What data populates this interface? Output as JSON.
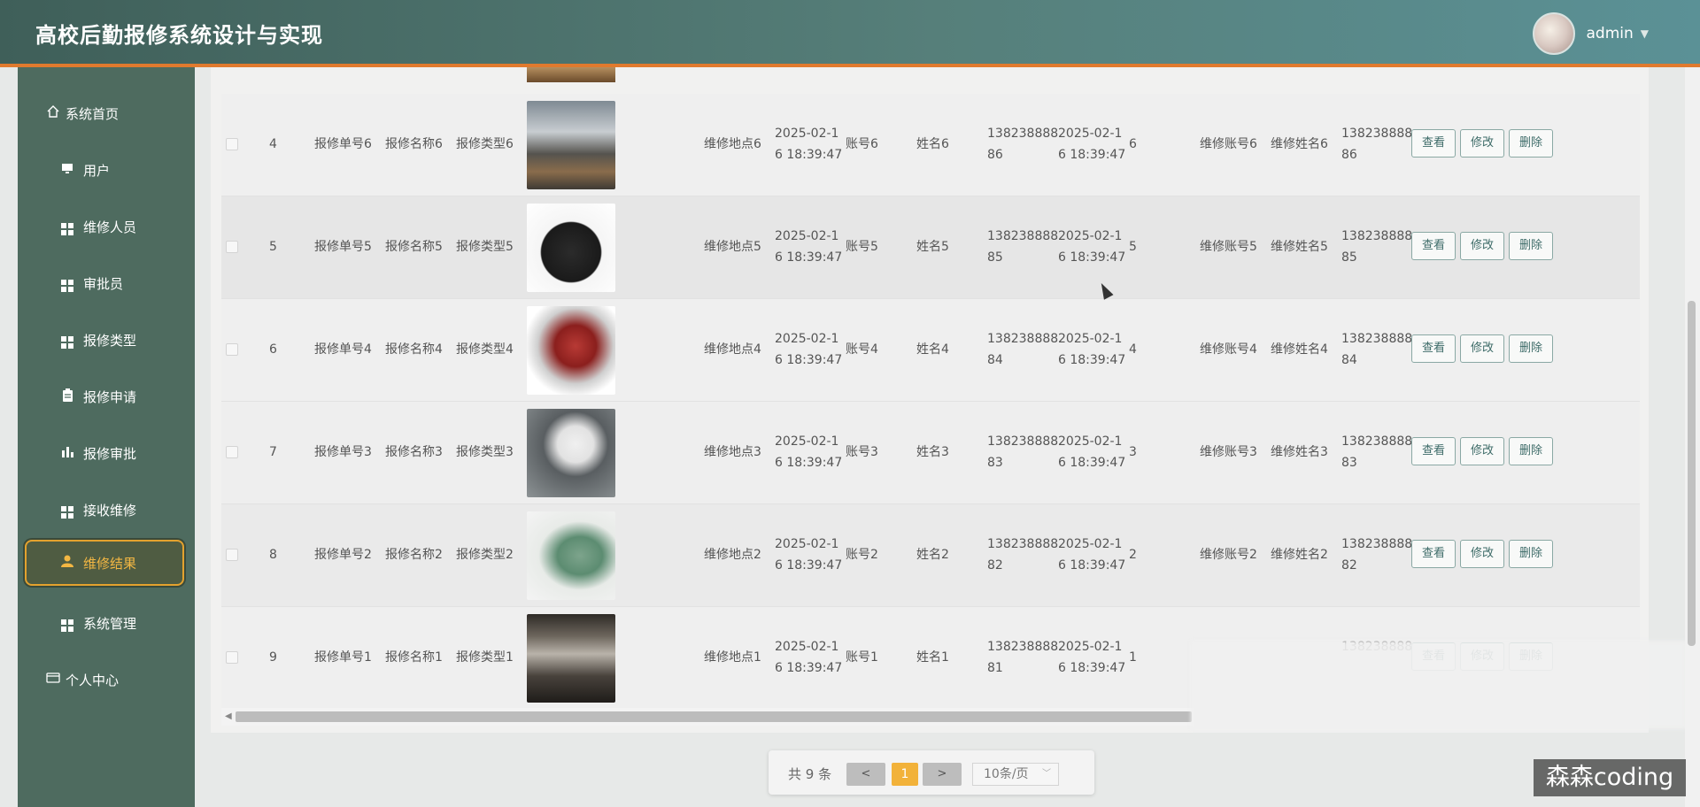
{
  "app": {
    "title": "高校后勤报修系统设计与实现"
  },
  "user": {
    "name": "admin",
    "caret": "▼"
  },
  "sidebar": {
    "items": [
      {
        "label": "系统首页",
        "icon": "home-icon"
      },
      {
        "label": "用户",
        "icon": "monitor-icon"
      },
      {
        "label": "维修人员",
        "icon": "grid-icon"
      },
      {
        "label": "审批员",
        "icon": "grid-icon"
      },
      {
        "label": "报修类型",
        "icon": "grid-icon"
      },
      {
        "label": "报修申请",
        "icon": "clipboard-icon"
      },
      {
        "label": "报修审批",
        "icon": "bar-chart-icon"
      },
      {
        "label": "接收维修",
        "icon": "grid-icon"
      },
      {
        "label": "维修结果",
        "icon": "user-icon",
        "active": true
      },
      {
        "label": "系统管理",
        "icon": "grid-icon"
      },
      {
        "label": "个人中心",
        "icon": "id-card-icon"
      }
    ]
  },
  "table": {
    "rows": [
      {
        "index": "4",
        "order_no": "报修单号6",
        "name": "报修名称6",
        "type": "报修类型6",
        "image": "kitchen",
        "location": "维修地点6",
        "time_a": "2025-02-1",
        "time_b": "6 18:39:47",
        "account": "账号6",
        "person": "姓名6",
        "phone_a": "138238888",
        "phone_b": "86",
        "time2_a": "2025-02-1",
        "time2_b": "6 18:39:47",
        "num": "6",
        "fix_account": "维修账号6",
        "fix_name": "维修姓名6",
        "fix_phone_a": "138238888",
        "fix_phone_b": "86"
      },
      {
        "index": "5",
        "order_no": "报修单号5",
        "name": "报修名称5",
        "type": "报修类型5",
        "image": "microwave",
        "location": "维修地点5",
        "time_a": "2025-02-1",
        "time_b": "6 18:39:47",
        "account": "账号5",
        "person": "姓名5",
        "phone_a": "138238888",
        "phone_b": "85",
        "time2_a": "2025-02-1",
        "time2_b": "6 18:39:47",
        "num": "5",
        "fix_account": "维修账号5",
        "fix_name": "维修姓名5",
        "fix_phone_a": "138238888",
        "fix_phone_b": "85"
      },
      {
        "index": "6",
        "order_no": "报修单号4",
        "name": "报修名称4",
        "type": "报修类型4",
        "image": "coffee-machine",
        "location": "维修地点4",
        "time_a": "2025-02-1",
        "time_b": "6 18:39:47",
        "account": "账号4",
        "person": "姓名4",
        "phone_a": "138238888",
        "phone_b": "84",
        "time2_a": "2025-02-1",
        "time2_b": "6 18:39:47",
        "num": "4",
        "fix_account": "维修账号4",
        "fix_name": "维修姓名4",
        "fix_phone_a": "138238888",
        "fix_phone_b": "84"
      },
      {
        "index": "7",
        "order_no": "报修单号3",
        "name": "报修名称3",
        "type": "报修类型3",
        "image": "robot-vacuum",
        "location": "维修地点3",
        "time_a": "2025-02-1",
        "time_b": "6 18:39:47",
        "account": "账号3",
        "person": "姓名3",
        "phone_a": "138238888",
        "phone_b": "83",
        "time2_a": "2025-02-1",
        "time2_b": "6 18:39:47",
        "num": "3",
        "fix_account": "维修账号3",
        "fix_name": "维修姓名3",
        "fix_phone_a": "138238888",
        "fix_phone_b": "83"
      },
      {
        "index": "8",
        "order_no": "报修单号2",
        "name": "报修名称2",
        "type": "报修类型2",
        "image": "kettle",
        "location": "维修地点2",
        "time_a": "2025-02-1",
        "time_b": "6 18:39:47",
        "account": "账号2",
        "person": "姓名2",
        "phone_a": "138238888",
        "phone_b": "82",
        "time2_a": "2025-02-1",
        "time2_b": "6 18:39:47",
        "num": "2",
        "fix_account": "维修账号2",
        "fix_name": "维修姓名2",
        "fix_phone_a": "138238888",
        "fix_phone_b": "82"
      },
      {
        "index": "9",
        "order_no": "报修单号1",
        "name": "报修名称1",
        "type": "报修类型1",
        "image": "appliance-store",
        "location": "维修地点1",
        "time_a": "2025-02-1",
        "time_b": "6 18:39:47",
        "account": "账号1",
        "person": "姓名1",
        "phone_a": "138238888",
        "phone_b": "81",
        "time2_a": "2025-02-1",
        "time2_b": "6 18:39:47",
        "num": "1",
        "fix_account": "",
        "fix_name": "",
        "fix_phone_a": "138238888",
        "fix_phone_b": ""
      }
    ],
    "actions": {
      "view": "查看",
      "edit": "修改",
      "delete": "删除"
    }
  },
  "pagination": {
    "total": "共 9 条",
    "prev": "<",
    "current": "1",
    "next": ">",
    "page_size": "10条/页"
  },
  "watermark": "森森coding",
  "colors": {
    "header_start": "#3f5f59",
    "header_end": "#5b9196",
    "accent": "#e07a2e",
    "sidebar": "#4e6b5f",
    "active": "#f3b743"
  }
}
